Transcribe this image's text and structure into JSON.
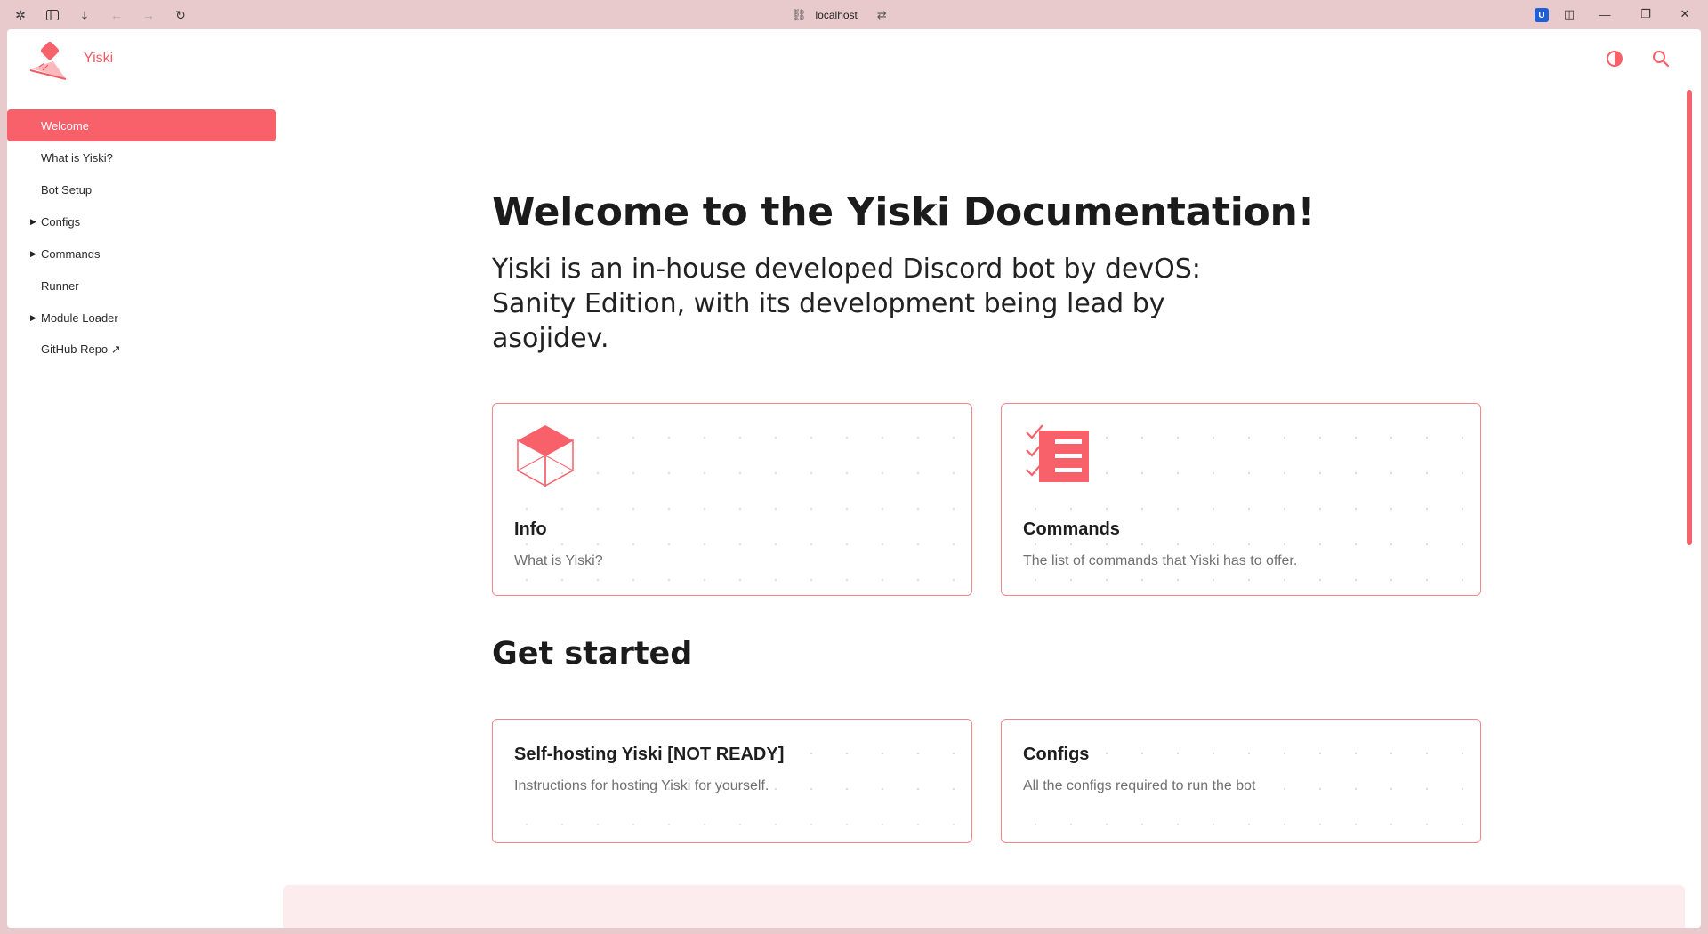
{
  "browser": {
    "url": "localhost",
    "icons": [
      "extensions-icon",
      "sidebar-icon",
      "download-icon",
      "back-icon",
      "forward-icon",
      "reload-icon"
    ]
  },
  "site": {
    "brand": "Yiski",
    "accent": "#f8606a"
  },
  "sidebar": {
    "items": [
      {
        "label": "Welcome",
        "active": true,
        "expandable": false
      },
      {
        "label": "What is Yiski?",
        "active": false,
        "expandable": false
      },
      {
        "label": "Bot Setup",
        "active": false,
        "expandable": false
      },
      {
        "label": "Configs",
        "active": false,
        "expandable": true
      },
      {
        "label": "Commands",
        "active": false,
        "expandable": true
      },
      {
        "label": "Runner",
        "active": false,
        "expandable": false
      },
      {
        "label": "Module Loader",
        "active": false,
        "expandable": true
      },
      {
        "label": "GitHub Repo ↗",
        "active": false,
        "expandable": false
      }
    ]
  },
  "main": {
    "title": "Welcome to the Yiski Documentation!",
    "lead": "Yiski is an in-house developed Discord bot by devOS: Sanity Edition, with its development being lead by asojidev.",
    "cards": [
      {
        "title": "Info",
        "desc": "What is Yiski?",
        "icon": "cube-icon"
      },
      {
        "title": "Commands",
        "desc": "The list of commands that Yiski has to offer.",
        "icon": "checklist-icon"
      }
    ],
    "get_started_title": "Get started",
    "start_cards": [
      {
        "title": "Self-hosting Yiski [NOT READY]",
        "desc": "Instructions for hosting Yiski for yourself."
      },
      {
        "title": "Configs",
        "desc": "All the configs required to run the bot"
      }
    ]
  }
}
